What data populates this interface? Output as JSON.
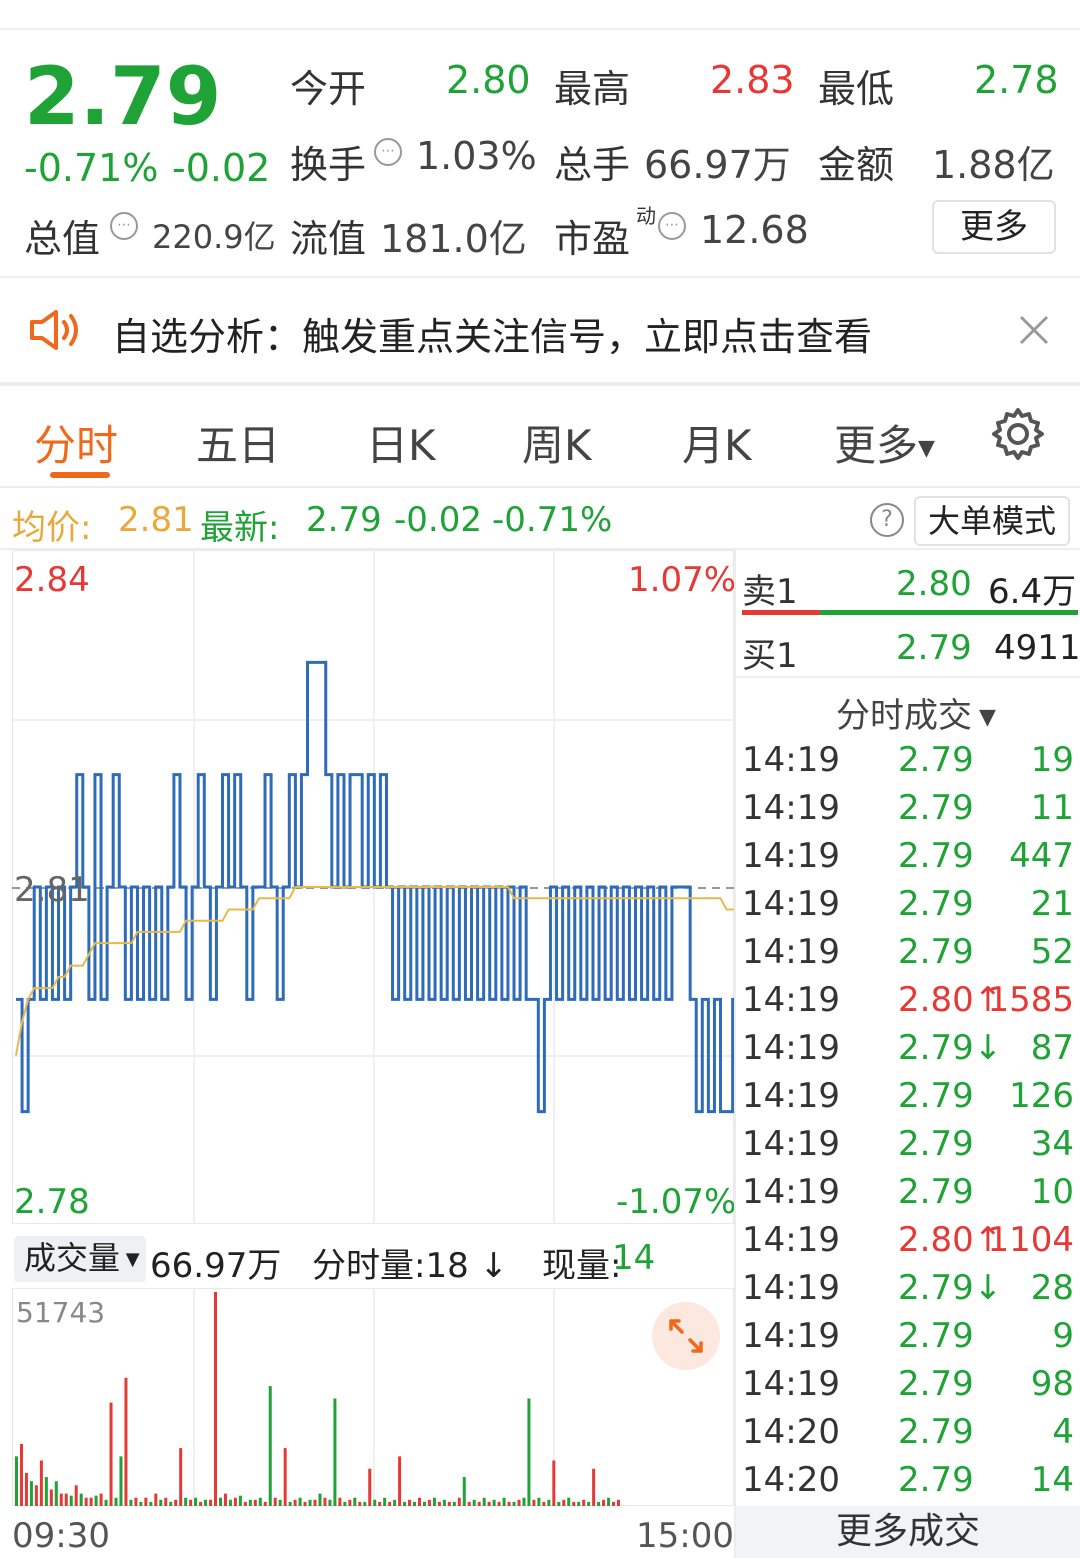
{
  "quote": {
    "price": "2.79",
    "change_pct": "-0.71%",
    "change_abs": "-0.02",
    "open_label": "今开",
    "open": "2.80",
    "high_label": "最高",
    "high": "2.83",
    "low_label": "最低",
    "low": "2.78",
    "turnover_label": "换手",
    "turnover": "1.03%",
    "volume_label": "总手",
    "volume": "66.97万",
    "amount_label": "金额",
    "amount": "1.88亿",
    "mcap_label": "总值",
    "mcap": "220.9亿",
    "float_label": "流值",
    "float": "181.0亿",
    "pe_label": "市盈",
    "pe_sup": "动",
    "pe": "12.68",
    "more_label": "更多"
  },
  "banner": {
    "text": "自选分析：触发重点关注信号，立即点击查看"
  },
  "tabs": [
    "分时",
    "五日",
    "日K",
    "周K",
    "月K",
    "更多"
  ],
  "subheader": {
    "avg_label": "均价:",
    "avg": "2.81",
    "latest_label": "最新:",
    "latest": "2.79",
    "latest_chg": "-0.02",
    "latest_pct": "-0.71%",
    "help": "?",
    "mode_button": "大单模式"
  },
  "chart_data": {
    "type": "line",
    "title": "",
    "ylim": [
      2.78,
      2.84
    ],
    "y_labels": {
      "top": "2.84",
      "mid": "2.81",
      "bottom": "2.78",
      "top_pct": "1.07%",
      "bottom_pct": "-1.07%"
    },
    "series": [
      {
        "values": [
          2.8,
          2.79,
          2.8,
          2.81,
          2.8,
          2.81,
          2.8,
          2.81,
          2.8,
          2.81,
          2.82,
          2.81,
          2.8,
          2.82,
          2.8,
          2.81,
          2.82,
          2.81,
          2.8,
          2.81,
          2.8,
          2.81,
          2.8,
          2.81,
          2.8,
          2.81,
          2.82,
          2.81,
          2.8,
          2.81,
          2.82,
          2.81,
          2.8,
          2.81,
          2.82,
          2.81,
          2.82,
          2.81,
          2.8,
          2.81,
          2.81,
          2.82,
          2.81,
          2.8,
          2.81,
          2.82,
          2.81,
          2.82,
          2.83,
          2.83,
          2.83,
          2.82,
          2.81,
          2.82,
          2.81,
          2.82,
          2.82,
          2.81,
          2.82,
          2.81,
          2.82,
          2.81,
          2.8,
          2.81,
          2.8,
          2.81,
          2.8,
          2.81,
          2.8,
          2.81,
          2.8,
          2.81,
          2.8,
          2.81,
          2.8,
          2.81,
          2.8,
          2.81,
          2.8,
          2.81,
          2.8,
          2.81,
          2.8,
          2.81,
          2.8,
          2.8,
          2.79,
          2.8,
          2.81,
          2.8,
          2.81,
          2.8,
          2.81,
          2.8,
          2.81,
          2.8,
          2.81,
          2.8,
          2.81,
          2.8,
          2.81,
          2.8,
          2.81,
          2.8,
          2.81,
          2.8,
          2.81,
          2.8,
          2.81,
          2.81,
          2.81,
          2.8,
          2.79,
          2.8,
          2.79,
          2.8,
          2.79,
          2.79,
          2.8,
          2.79,
          2.79,
          2.79
        ]
      },
      {
        "values": [
          2.795,
          2.798,
          2.8,
          2.801,
          2.801,
          2.801,
          2.801,
          2.802,
          2.802,
          2.803,
          2.803,
          2.803,
          2.804,
          2.805,
          2.805,
          2.805,
          2.805,
          2.805,
          2.805,
          2.805,
          2.806,
          2.806,
          2.806,
          2.806,
          2.806,
          2.806,
          2.806,
          2.806,
          2.807,
          2.807,
          2.807,
          2.807,
          2.807,
          2.807,
          2.807,
          2.808,
          2.808,
          2.808,
          2.808,
          2.808,
          2.809,
          2.809,
          2.809,
          2.809,
          2.809,
          2.809,
          2.81,
          2.81,
          2.81,
          2.81,
          2.81,
          2.81,
          2.81,
          2.81,
          2.81,
          2.81,
          2.81,
          2.81,
          2.81,
          2.81,
          2.81,
          2.81,
          2.81,
          2.81,
          2.81,
          2.81,
          2.81,
          2.81,
          2.81,
          2.81,
          2.81,
          2.81,
          2.81,
          2.81,
          2.81,
          2.81,
          2.81,
          2.81,
          2.81,
          2.81,
          2.81,
          2.81,
          2.809,
          2.809,
          2.809,
          2.809,
          2.809,
          2.809,
          2.809,
          2.809,
          2.809,
          2.809,
          2.809,
          2.809,
          2.809,
          2.809,
          2.809,
          2.809,
          2.809,
          2.809,
          2.809,
          2.809,
          2.809,
          2.809,
          2.809,
          2.809,
          2.809,
          2.809,
          2.809,
          2.809,
          2.809,
          2.809,
          2.809,
          2.809,
          2.809,
          2.809,
          2.809,
          2.808,
          2.808,
          2.808,
          2.808,
          2.808
        ]
      }
    ],
    "x_labels": [
      "09:30",
      "15:00"
    ]
  },
  "volume": {
    "tab_label": "成交量",
    "total": "66.97万",
    "minute_label": "分时量:18",
    "current_label": "现量:",
    "current": "14",
    "max_label": "51743",
    "chart_data": {
      "type": "bar",
      "ylim": [
        0,
        51743
      ],
      "values": [
        12000,
        15000,
        8000,
        6000,
        5000,
        11000,
        7000,
        4000,
        6000,
        3000,
        3000,
        2500,
        5000,
        3000,
        2000,
        2000,
        2500,
        3000,
        1500,
        25000,
        2000,
        12000,
        31000,
        1500,
        2000,
        1000,
        2000,
        1000,
        3000,
        1500,
        2000,
        1000,
        1500,
        14000,
        2000,
        1500,
        2000,
        1000,
        1500,
        1500,
        51743,
        2000,
        3000,
        1500,
        2000,
        2500,
        1000,
        1500,
        1500,
        2000,
        1000,
        29000,
        2000,
        1500,
        14000,
        1000,
        1500,
        2000,
        1000,
        1500,
        1500,
        3000,
        2000,
        1500,
        26000,
        2000,
        1000,
        1500,
        2000,
        1000,
        1000,
        9000,
        1500,
        1000,
        2000,
        1000,
        1500,
        12000,
        1000,
        1500,
        1000,
        2000,
        1000,
        1500,
        2000,
        1000,
        1500,
        1000,
        1000,
        2000,
        7000,
        1000,
        1500,
        1000,
        2000,
        1000,
        1500,
        1000,
        2000,
        1000,
        1000,
        1500,
        2000,
        26000,
        1500,
        2000,
        1000,
        1500,
        11000,
        1000,
        1500,
        2000,
        1000,
        1000,
        1500,
        1000,
        9000,
        1000,
        1500,
        2000,
        1000,
        1500
      ],
      "colors": [
        "g",
        "r",
        "r",
        "g",
        "r",
        "r",
        "g",
        "r",
        "g",
        "r",
        "r",
        "g",
        "r",
        "g",
        "r",
        "r",
        "g",
        "r",
        "g",
        "r",
        "g",
        "g",
        "r",
        "g",
        "r",
        "g",
        "r",
        "g",
        "r",
        "g",
        "r",
        "g",
        "r",
        "r",
        "g",
        "r",
        "g",
        "r",
        "g",
        "r",
        "r",
        "g",
        "r",
        "g",
        "r",
        "g",
        "r",
        "g",
        "r",
        "g",
        "r",
        "g",
        "r",
        "g",
        "r",
        "g",
        "r",
        "g",
        "r",
        "g",
        "r",
        "g",
        "r",
        "g",
        "g",
        "r",
        "g",
        "r",
        "g",
        "r",
        "g",
        "r",
        "g",
        "r",
        "g",
        "r",
        "g",
        "r",
        "g",
        "r",
        "g",
        "r",
        "g",
        "r",
        "g",
        "r",
        "g",
        "r",
        "g",
        "r",
        "g",
        "r",
        "g",
        "r",
        "g",
        "r",
        "g",
        "r",
        "g",
        "r",
        "g",
        "r",
        "g",
        "g",
        "r",
        "g",
        "r",
        "g",
        "r",
        "g",
        "r",
        "g",
        "r",
        "g",
        "r",
        "g",
        "r",
        "g",
        "r",
        "g",
        "r",
        "r"
      ]
    }
  },
  "orderbook": {
    "sell_label": "卖1",
    "sell_price": "2.80",
    "sell_vol": "6.4万",
    "buy_label": "买1",
    "buy_price": "2.79",
    "buy_vol": "4911"
  },
  "trades_header": "分时成交",
  "trades": [
    {
      "time": "14:19",
      "price": "2.79",
      "vol": "19",
      "dir": "green"
    },
    {
      "time": "14:19",
      "price": "2.79",
      "vol": "11",
      "dir": "green"
    },
    {
      "time": "14:19",
      "price": "2.79",
      "vol": "447",
      "dir": "green"
    },
    {
      "time": "14:19",
      "price": "2.79",
      "vol": "21",
      "dir": "green"
    },
    {
      "time": "14:19",
      "price": "2.79",
      "vol": "52",
      "dir": "green"
    },
    {
      "time": "14:19",
      "price": "2.80↑",
      "vol": "1585",
      "dir": "red"
    },
    {
      "time": "14:19",
      "price": "2.79↓",
      "vol": "87",
      "dir": "green"
    },
    {
      "time": "14:19",
      "price": "2.79",
      "vol": "126",
      "dir": "green"
    },
    {
      "time": "14:19",
      "price": "2.79",
      "vol": "34",
      "dir": "green"
    },
    {
      "time": "14:19",
      "price": "2.79",
      "vol": "10",
      "dir": "green"
    },
    {
      "time": "14:19",
      "price": "2.80↑",
      "vol": "1104",
      "dir": "red"
    },
    {
      "time": "14:19",
      "price": "2.79↓",
      "vol": "28",
      "dir": "green"
    },
    {
      "time": "14:19",
      "price": "2.79",
      "vol": "9",
      "dir": "green"
    },
    {
      "time": "14:19",
      "price": "2.79",
      "vol": "98",
      "dir": "green"
    },
    {
      "time": "14:20",
      "price": "2.79",
      "vol": "4",
      "dir": "green"
    },
    {
      "time": "14:20",
      "price": "2.79",
      "vol": "14",
      "dir": "green"
    }
  ],
  "more_trades": "更多成交",
  "colors": {
    "green": "#1fa337",
    "red": "#e53935",
    "accent": "#f0681a",
    "price_line": "#2e6bb8",
    "avg_line": "#e8b84a"
  }
}
